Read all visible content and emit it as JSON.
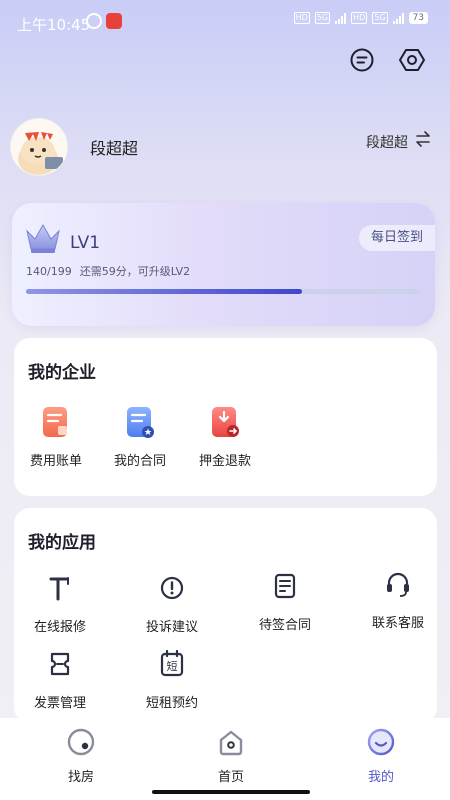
{
  "status_bar": {
    "time": "上午10:45",
    "network_1": "5G",
    "network_2": "5G",
    "battery": "73"
  },
  "header": {
    "message_icon": "message-icon",
    "settings_icon": "settings-hex-icon"
  },
  "profile": {
    "name": "段超超",
    "switch_name": "段超超",
    "switch_icon": "switch-arrows-icon"
  },
  "level": {
    "level_label": "LV1",
    "checkin_label": "每日签到",
    "points": "140/199",
    "upgrade_hint": "还需59分，可升级LV2",
    "progress": 0.7
  },
  "enterprise": {
    "title": "我的企业",
    "items": [
      {
        "label": "费用账单",
        "icon": "bill-icon"
      },
      {
        "label": "我的合同",
        "icon": "contract-icon"
      },
      {
        "label": "押金退款",
        "icon": "refund-icon"
      }
    ]
  },
  "apps": {
    "title": "我的应用",
    "items": [
      {
        "label": "在线报修",
        "icon": "repair-icon"
      },
      {
        "label": "投诉建议",
        "icon": "complaint-icon"
      },
      {
        "label": "待签合同",
        "icon": "pending-contract-icon"
      },
      {
        "label": "联系客服",
        "icon": "headset-icon"
      },
      {
        "label": "发票管理",
        "icon": "invoice-icon"
      },
      {
        "label": "短租预约",
        "icon": "short-rent-icon"
      }
    ],
    "short_rent_glyph": "短"
  },
  "tabbar": {
    "tabs": [
      {
        "label": "找房",
        "icon": "find-house-icon"
      },
      {
        "label": "首页",
        "icon": "home-icon"
      },
      {
        "label": "我的",
        "icon": "mine-icon"
      }
    ],
    "active_index": 2,
    "accent": "#5559c8"
  }
}
